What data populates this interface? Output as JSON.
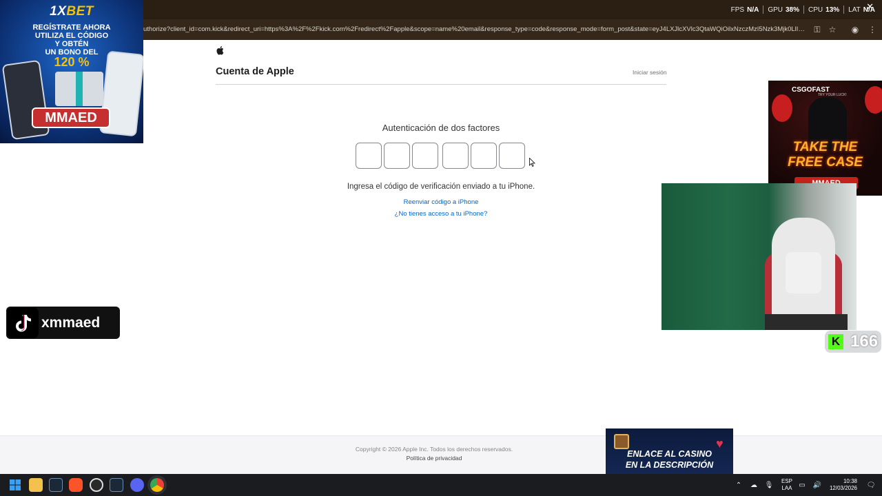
{
  "osd": {
    "fps_label": "FPS",
    "fps_value": "N/A",
    "gpu_label": "GPU",
    "gpu_value": "38%",
    "cpu_label": "CPU",
    "cpu_value": "13%",
    "lat_label": "LAT",
    "lat_value": "N/A"
  },
  "browser": {
    "url": "uthorize?client_id=com.kick&redirect_uri=https%3A%2F%2Fkick.com%2Fredirect%2Fapple&scope=name%20email&response_type=code&response_mode=form_post&state=eyJ4LXJlcXVlc3QtaWQiOilxNzczMzI5Nzk3Mjk0LlI6ZW0zT..."
  },
  "page": {
    "brand_title": "Cuenta de Apple",
    "signin_link": "Iniciar sesión",
    "auth_heading": "Autenticación de dos factores",
    "code_digits": [
      "",
      "",
      "",
      "",
      "",
      ""
    ],
    "instructions": "Ingresa el código de verificación enviado a tu iPhone.",
    "resend_link": "Reenviar código a iPhone",
    "no_access_link": "¿No tienes acceso a tu iPhone?",
    "copyright": "Copyright © 2026 Apple Inc. Todos los derechos reservados.",
    "privacy_link": "Política de privacidad"
  },
  "overlays": {
    "bet_ad": {
      "brand_a": "1X",
      "brand_b": "BET",
      "line1": "REGÍSTRATE AHORA",
      "line2": "UTILIZA EL CÓDIGO",
      "line3": "Y OBTÉN",
      "line4": "UN BONO DEL",
      "percent": "120 %",
      "code": "MMAED"
    },
    "tiktok": {
      "handle": "xmmaed"
    },
    "csgo_ad": {
      "logo": "CSGOFAST",
      "tagline": "TRY YOUR LUCK!",
      "headline1": "TAKE THE",
      "headline2": "FREE CASE",
      "code": "MMAED"
    },
    "kick": {
      "icon": "K",
      "viewers": "166"
    },
    "casino_ad": {
      "line1": "ENLACE AL CASINO",
      "line2": "EN LA DESCRIPCIÓN"
    }
  },
  "taskbar": {
    "lang_top": "ESP",
    "lang_bottom": "LAA",
    "time": "10:38",
    "date": "12/03/2026",
    "icons": [
      "windows-start-icon",
      "file-explorer-icon",
      "steam-icon",
      "brave-icon",
      "app-icon",
      "steam-icon",
      "discord-icon",
      "chrome-icon"
    ]
  },
  "colors": {
    "link_blue": "#0066cc",
    "kick_green": "#53fc18",
    "chrome_dark": "#2b1e12"
  }
}
